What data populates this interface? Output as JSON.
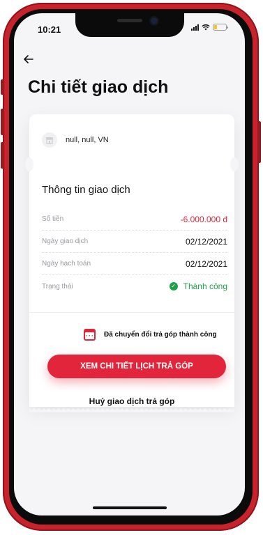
{
  "status_bar": {
    "time": "10:21"
  },
  "page": {
    "title": "Chi tiết giao dịch"
  },
  "merchant": {
    "name": "null, null, VN"
  },
  "transaction": {
    "section_title": "Thông tin giao dịch",
    "rows": [
      {
        "label": "Số tiền",
        "value": "-6.000.000 đ"
      },
      {
        "label": "Ngày giao dịch",
        "value": "02/12/2021"
      },
      {
        "label": "Ngày hạch toán",
        "value": "02/12/2021"
      },
      {
        "label": "Trạng thái",
        "value": "Thành công"
      }
    ]
  },
  "installment": {
    "note": "Đã chuyển đổi trả góp thành công",
    "view_button": "XEM CHI TIẾT LỊCH TRẢ GÓP",
    "cancel_link": "Huỷ giao dịch trả góp"
  },
  "colors": {
    "accent": "#e3253b",
    "negative": "#e0243a",
    "success": "#1fa14b",
    "frame": "#c8232c"
  },
  "icons": [
    "back-arrow-icon",
    "store-icon",
    "check-circle-icon",
    "calendar-icon",
    "signal-icon",
    "wifi-icon",
    "battery-icon"
  ]
}
